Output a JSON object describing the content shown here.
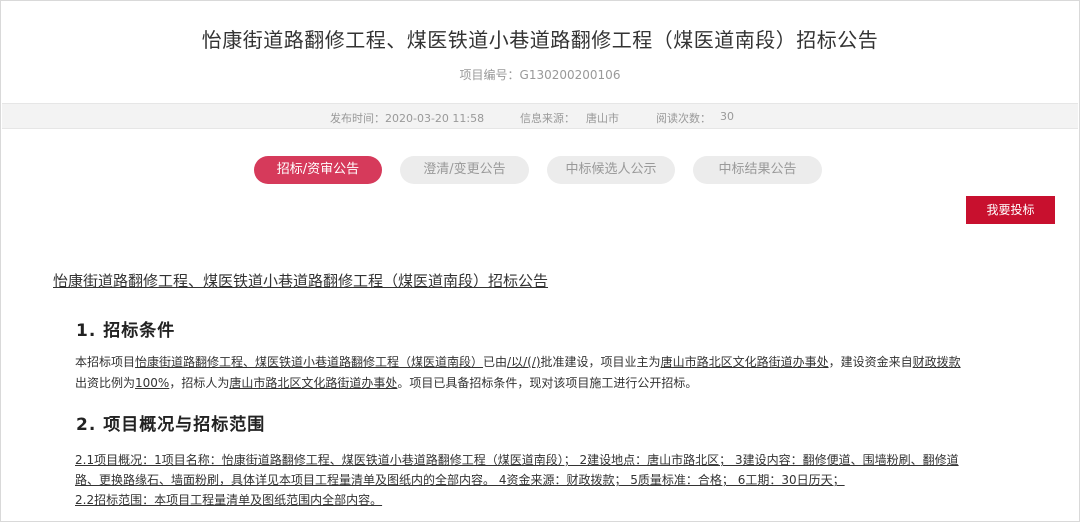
{
  "page": {
    "title": "怡康街道路翻修工程、煤医铁道小巷道路翻修工程（煤医道南段）招标公告",
    "project_no": "项目编号：G130200200106"
  },
  "meta": {
    "publish_time": "发布时间：2020-03-20 11:58",
    "source_label": "信息来源：",
    "source_value": "唐山市",
    "views_label": "阅读次数：",
    "views_value": "30"
  },
  "tabs": [
    {
      "label": "招标/资审公告",
      "active": true
    },
    {
      "label": "澄清/变更公告",
      "active": false
    },
    {
      "label": "中标候选人公示",
      "active": false
    },
    {
      "label": "中标结果公告",
      "active": false
    }
  ],
  "bid_button": "我要投标",
  "doc": {
    "title": "怡康街道路翻修工程、煤医铁道小巷道路翻修工程（煤医道南段）招标公告",
    "section1_heading": "1.  招标条件",
    "s1_p1_a": "本招标项目",
    "s1_p1_b": "怡康街道路翻修工程、煤医铁道小巷道路翻修工程（煤医道南段）",
    "s1_p1_c": "已由",
    "s1_p1_d": "/以/(/)",
    "s1_p1_e": "批准建设，项目业主为",
    "s1_p1_f": "唐山市路北区文化路街道办事处",
    "s1_p1_g": "，建设资金来自",
    "s1_p1_h": "财政拨款",
    "s1_p2_a": "出资比例为",
    "s1_p2_b": "100%",
    "s1_p2_c": "，招标人为",
    "s1_p2_d": "唐山市路北区文化路街道办事处",
    "s1_p2_e": "。项目已具备招标条件，现对该项目施工进行公开招标。",
    "section2_heading": "2.  项目概况与招标范围",
    "s2_l1": "2.1项目概况：1项目名称：怡康街道路翻修工程、煤医铁道小巷道路翻修工程（煤医道南段）； 2建设地点：唐山市路北区； 3建设内容：翻修便道、围墙粉刷、翻修道",
    "s2_l2": "路、更换路缘石、墙面粉刷，具体详见本项目工程量清单及图纸内的全部内容。 4资金来源：财政拨款； 5质量标准：合格； 6工期：30日历天；",
    "s2_l3": "2.2招标范围：本项目工程量清单及图纸范围内全部内容。"
  },
  "colors": {
    "accent": "#d63a5b",
    "button": "#c8102e",
    "meta_bg": "#f3f3f3"
  }
}
